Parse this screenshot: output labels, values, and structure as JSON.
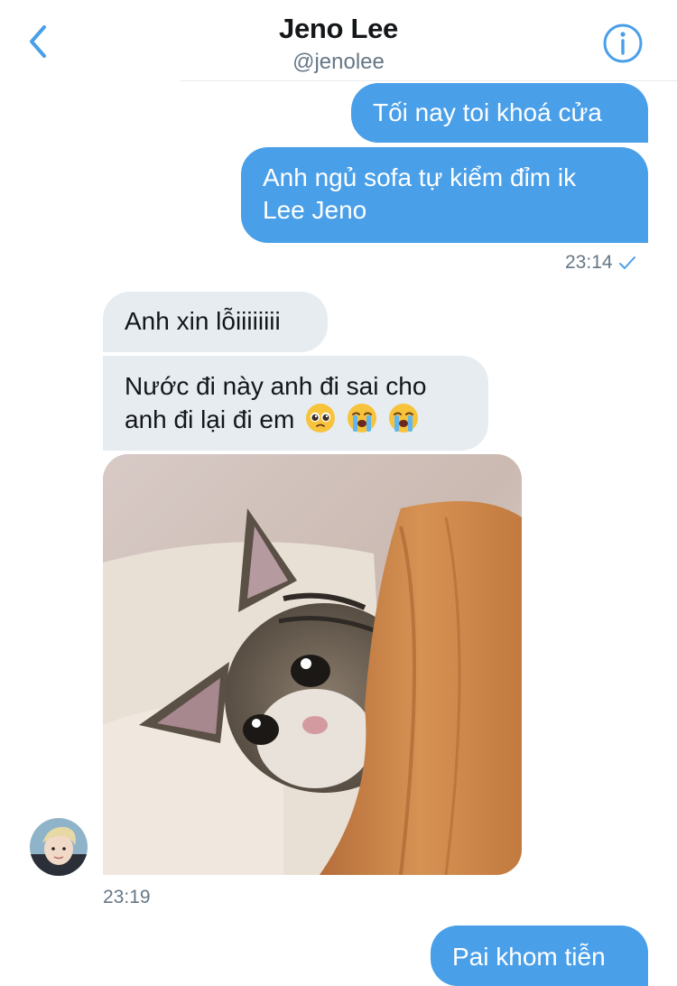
{
  "header": {
    "title": "Jeno Lee",
    "handle": "@jenolee",
    "back_icon": "chevron-left-icon",
    "info_icon": "info-icon"
  },
  "messages": {
    "out1": "Tối nay toi khoá cửa",
    "out2_line1": "Anh ngủ sofa tự kiểm đỉm ik",
    "out2_line2": "Lee Jeno",
    "out_time": "23:14",
    "in1": "Anh xin lỗiiiiiiii",
    "in2_line1": "Nước đi này anh đi sai cho",
    "in2_line2": "anh đi lại đi em",
    "in2_emojis": [
      "pleading-face",
      "loudly-crying-face",
      "loudly-crying-face"
    ],
    "in_time": "23:19",
    "out3": "Pai khom tiễn"
  },
  "colors": {
    "accent": "#4a9fe9",
    "incoming_bubble": "#e6ecf0",
    "muted_text": "#657786"
  }
}
